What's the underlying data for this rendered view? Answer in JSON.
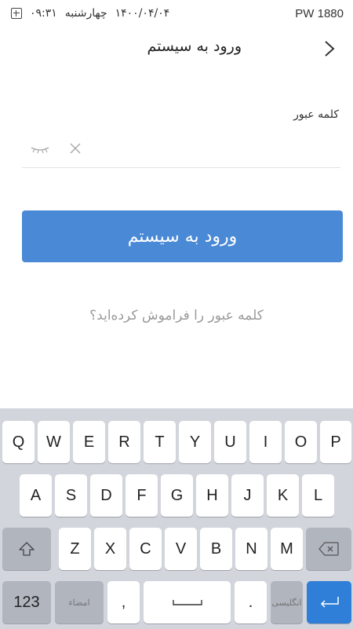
{
  "status_bar": {
    "time": "۰۹:۳۱",
    "day": "چهارشنبه",
    "date": "۱۴۰۰/۰۴/۰۴",
    "device": "PW 1880"
  },
  "header": {
    "title": "ورود به سیستم"
  },
  "form": {
    "password_label": "کلمه عبور",
    "password_value": "",
    "password_placeholder": ""
  },
  "login_button_label": "ورود به سیستم",
  "forgot_link": "کلمه عبور را فراموش کرده‌اید؟",
  "keyboard": {
    "row1": [
      "Q",
      "W",
      "E",
      "R",
      "T",
      "Y",
      "U",
      "I",
      "O",
      "P"
    ],
    "row2": [
      "A",
      "S",
      "D",
      "F",
      "G",
      "H",
      "J",
      "K",
      "L"
    ],
    "row3": [
      "Z",
      "X",
      "C",
      "V",
      "B",
      "N",
      "M"
    ],
    "numbers_key": "123",
    "signature_key": "امضاء",
    "comma_key": ",",
    "period_key": ".",
    "language_key": "انگلیسی"
  },
  "colors": {
    "accent": "#4a89d6",
    "enter_key": "#2f7fd8",
    "keyboard_bg": "#d2d5db"
  }
}
